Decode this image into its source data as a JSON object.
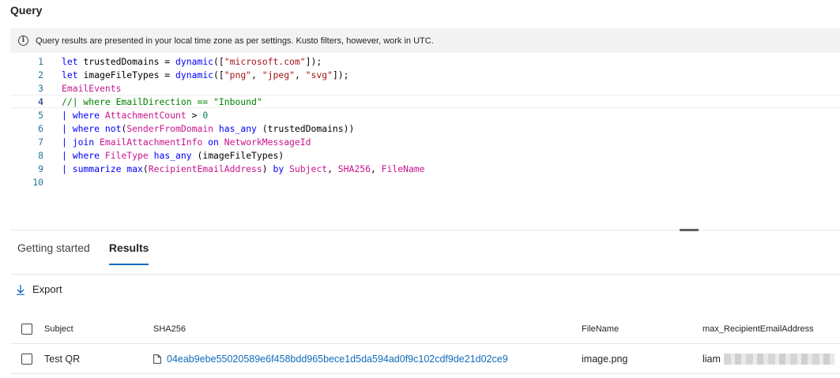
{
  "header": {
    "title": "Query"
  },
  "info_bar": {
    "icon": "info-icon",
    "text": "Query results are presented in your local time zone as per settings. Kusto filters, however, work in UTC."
  },
  "editor": {
    "lines": [
      {
        "number": "1",
        "tokens": [
          {
            "t": "let ",
            "c": "kw"
          },
          {
            "t": "trustedDomains = ",
            "c": "op"
          },
          {
            "t": "dynamic",
            "c": "fn"
          },
          {
            "t": "([",
            "c": "op"
          },
          {
            "t": "\"microsoft.com\"",
            "c": "str"
          },
          {
            "t": "]);",
            "c": "op"
          }
        ]
      },
      {
        "number": "2",
        "tokens": [
          {
            "t": "let ",
            "c": "kw"
          },
          {
            "t": "imageFileTypes = ",
            "c": "op"
          },
          {
            "t": "dynamic",
            "c": "fn"
          },
          {
            "t": "([",
            "c": "op"
          },
          {
            "t": "\"png\"",
            "c": "str"
          },
          {
            "t": ", ",
            "c": "op"
          },
          {
            "t": "\"jpeg\"",
            "c": "str"
          },
          {
            "t": ", ",
            "c": "op"
          },
          {
            "t": "\"svg\"",
            "c": "str"
          },
          {
            "t": "]);",
            "c": "op"
          }
        ]
      },
      {
        "number": "3",
        "tokens": [
          {
            "t": "EmailEvents",
            "c": "tbl"
          }
        ]
      },
      {
        "number": "4",
        "current": true,
        "tokens": [
          {
            "t": "//| where EmailDirection == \"Inbound\"",
            "c": "cmt"
          }
        ]
      },
      {
        "number": "5",
        "tokens": [
          {
            "t": "| ",
            "c": "pipe"
          },
          {
            "t": "where ",
            "c": "kw"
          },
          {
            "t": "AttachmentCount",
            "c": "col"
          },
          {
            "t": " > ",
            "c": "op"
          },
          {
            "t": "0",
            "c": "num"
          }
        ]
      },
      {
        "number": "6",
        "tokens": [
          {
            "t": "| ",
            "c": "pipe"
          },
          {
            "t": "where ",
            "c": "kw"
          },
          {
            "t": "not",
            "c": "fn"
          },
          {
            "t": "(",
            "c": "op"
          },
          {
            "t": "SenderFromDomain",
            "c": "col"
          },
          {
            "t": " ",
            "c": "op"
          },
          {
            "t": "has_any",
            "c": "kw"
          },
          {
            "t": " (trustedDomains))",
            "c": "op"
          }
        ]
      },
      {
        "number": "7",
        "tokens": [
          {
            "t": "| ",
            "c": "pipe"
          },
          {
            "t": "join ",
            "c": "kw"
          },
          {
            "t": "EmailAttachmentInfo",
            "c": "tbl"
          },
          {
            "t": " on ",
            "c": "kw"
          },
          {
            "t": "NetworkMessageId",
            "c": "col"
          }
        ]
      },
      {
        "number": "8",
        "tokens": [
          {
            "t": "| ",
            "c": "pipe"
          },
          {
            "t": "where ",
            "c": "kw"
          },
          {
            "t": "FileType",
            "c": "col"
          },
          {
            "t": " ",
            "c": "op"
          },
          {
            "t": "has_any",
            "c": "kw"
          },
          {
            "t": " (imageFileTypes)",
            "c": "op"
          }
        ]
      },
      {
        "number": "9",
        "tokens": [
          {
            "t": "| ",
            "c": "pipe"
          },
          {
            "t": "summarize ",
            "c": "kw"
          },
          {
            "t": "max",
            "c": "fn"
          },
          {
            "t": "(",
            "c": "op"
          },
          {
            "t": "RecipientEmailAddress",
            "c": "col"
          },
          {
            "t": ") ",
            "c": "op"
          },
          {
            "t": "by ",
            "c": "kw"
          },
          {
            "t": "Subject",
            "c": "col"
          },
          {
            "t": ", ",
            "c": "op"
          },
          {
            "t": "SHA256",
            "c": "col"
          },
          {
            "t": ", ",
            "c": "op"
          },
          {
            "t": "FileName",
            "c": "col"
          }
        ]
      },
      {
        "number": "10",
        "tokens": []
      }
    ]
  },
  "tabs": [
    {
      "label": "Getting started",
      "active": false
    },
    {
      "label": "Results",
      "active": true
    }
  ],
  "toolbar": {
    "export_label": "Export",
    "export_icon": "download-icon"
  },
  "table": {
    "columns": [
      "Subject",
      "SHA256",
      "FileName",
      "max_RecipientEmailAddress"
    ],
    "rows": [
      {
        "subject": "Test QR",
        "sha256": "04eab9ebe55020589e6f458bdd965bece1d5da594ad0f9c102cdf9de21d02ce9",
        "filename": "image.png",
        "email_visible": "liam"
      }
    ]
  },
  "colors": {
    "accent": "#0f6cbd",
    "info_bar_bg": "#f3f3f3",
    "line_number": "#237893"
  }
}
